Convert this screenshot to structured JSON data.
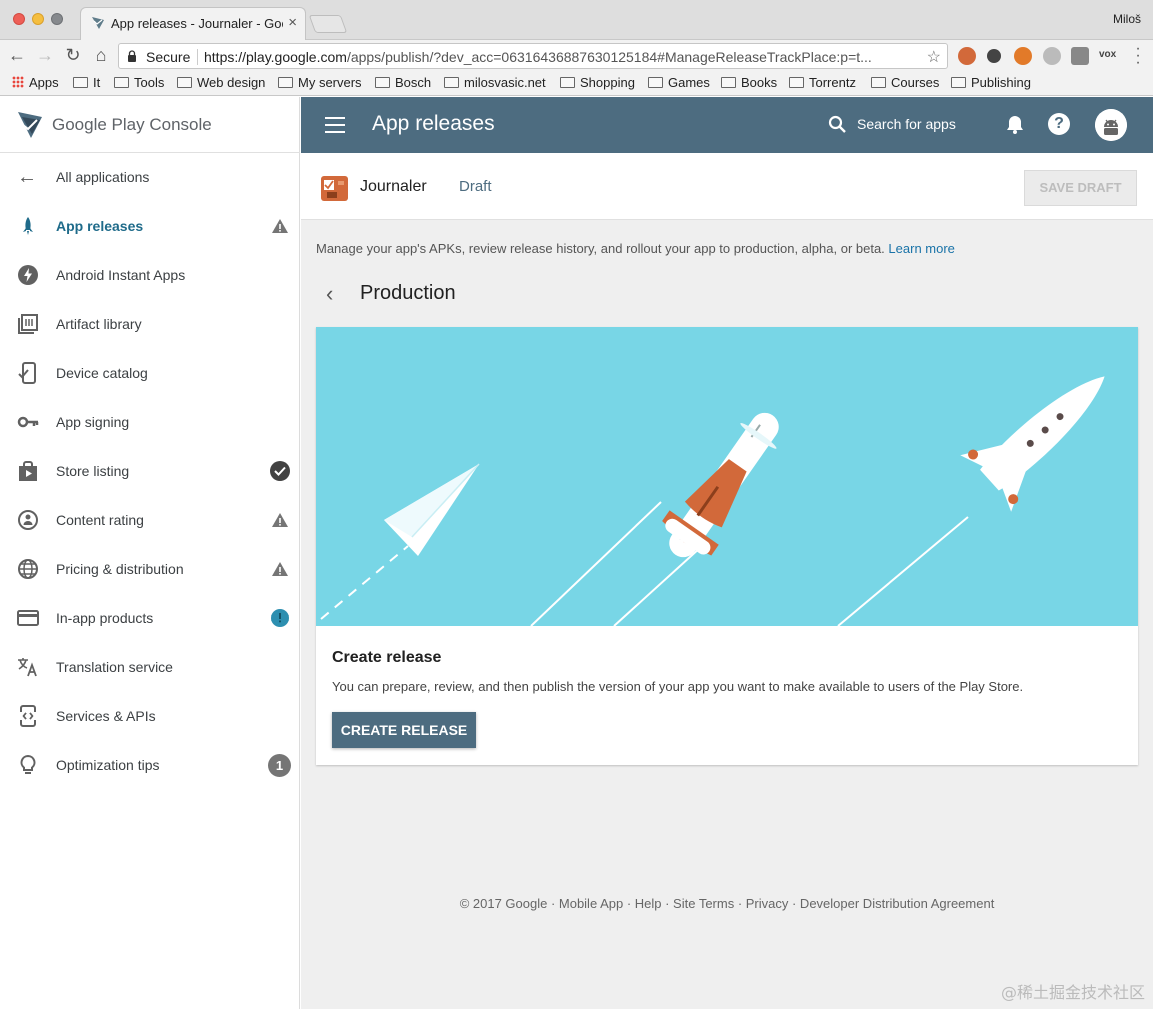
{
  "browser": {
    "tab_title": "App releases - Journaler - Goo",
    "profile": "Miloš",
    "secure_label": "Secure",
    "url_domain": "https://play.google.com",
    "url_path": "/apps/publish/?dev_acc=06316436887630125184#ManageReleaseTrackPlace:p=t...",
    "ext_vox": "vox",
    "bookmarks": [
      "Apps",
      "It",
      "Tools",
      "Web design",
      "My servers",
      "Bosch",
      "milosvasic.net",
      "Shopping",
      "Games",
      "Books",
      "Torrentz",
      "Courses",
      "Publishing"
    ]
  },
  "sidebar": {
    "logo_text": "Google Play Console",
    "back_label": "All applications",
    "items": [
      {
        "label": "App releases",
        "icon": "rocket-icon",
        "status": "warning",
        "active": true
      },
      {
        "label": "Android Instant Apps",
        "icon": "bolt-icon",
        "status": ""
      },
      {
        "label": "Artifact library",
        "icon": "library-icon",
        "status": ""
      },
      {
        "label": "Device catalog",
        "icon": "device-icon",
        "status": ""
      },
      {
        "label": "App signing",
        "icon": "key-icon",
        "status": ""
      },
      {
        "label": "Store listing",
        "icon": "store-icon",
        "status": "done"
      },
      {
        "label": "Content rating",
        "icon": "rating-icon",
        "status": "warning"
      },
      {
        "label": "Pricing & distribution",
        "icon": "globe-icon",
        "status": "warning"
      },
      {
        "label": "In-app products",
        "icon": "card-icon",
        "status": "info"
      },
      {
        "label": "Translation service",
        "icon": "translate-icon",
        "status": ""
      },
      {
        "label": "Services & APIs",
        "icon": "code-icon",
        "status": ""
      },
      {
        "label": "Optimization tips",
        "icon": "bulb-icon",
        "badge": "1"
      }
    ]
  },
  "header": {
    "title": "App releases",
    "search_label": "Search for apps"
  },
  "app": {
    "name": "Journaler",
    "status": "Draft",
    "save_label": "SAVE DRAFT"
  },
  "content": {
    "intro": "Manage your app's APKs, review release history, and rollout your app to production, alpha, or beta.",
    "learn_more": "Learn more",
    "section_title": "Production",
    "card_title": "Create release",
    "card_text": "You can prepare, review, and then publish the version of your app you want to make available to users of the Play Store.",
    "create_label": "CREATE RELEASE"
  },
  "footer": "© 2017 Google · Mobile App · Help · Site Terms · Privacy · Developer Distribution Agreement",
  "watermark": "@稀土掘金技术社区",
  "colors": {
    "header_bg": "#4d6c80",
    "illustration_bg": "#78d6e6",
    "accent_orange": "#d2693a",
    "warning_gray": "#757575"
  }
}
